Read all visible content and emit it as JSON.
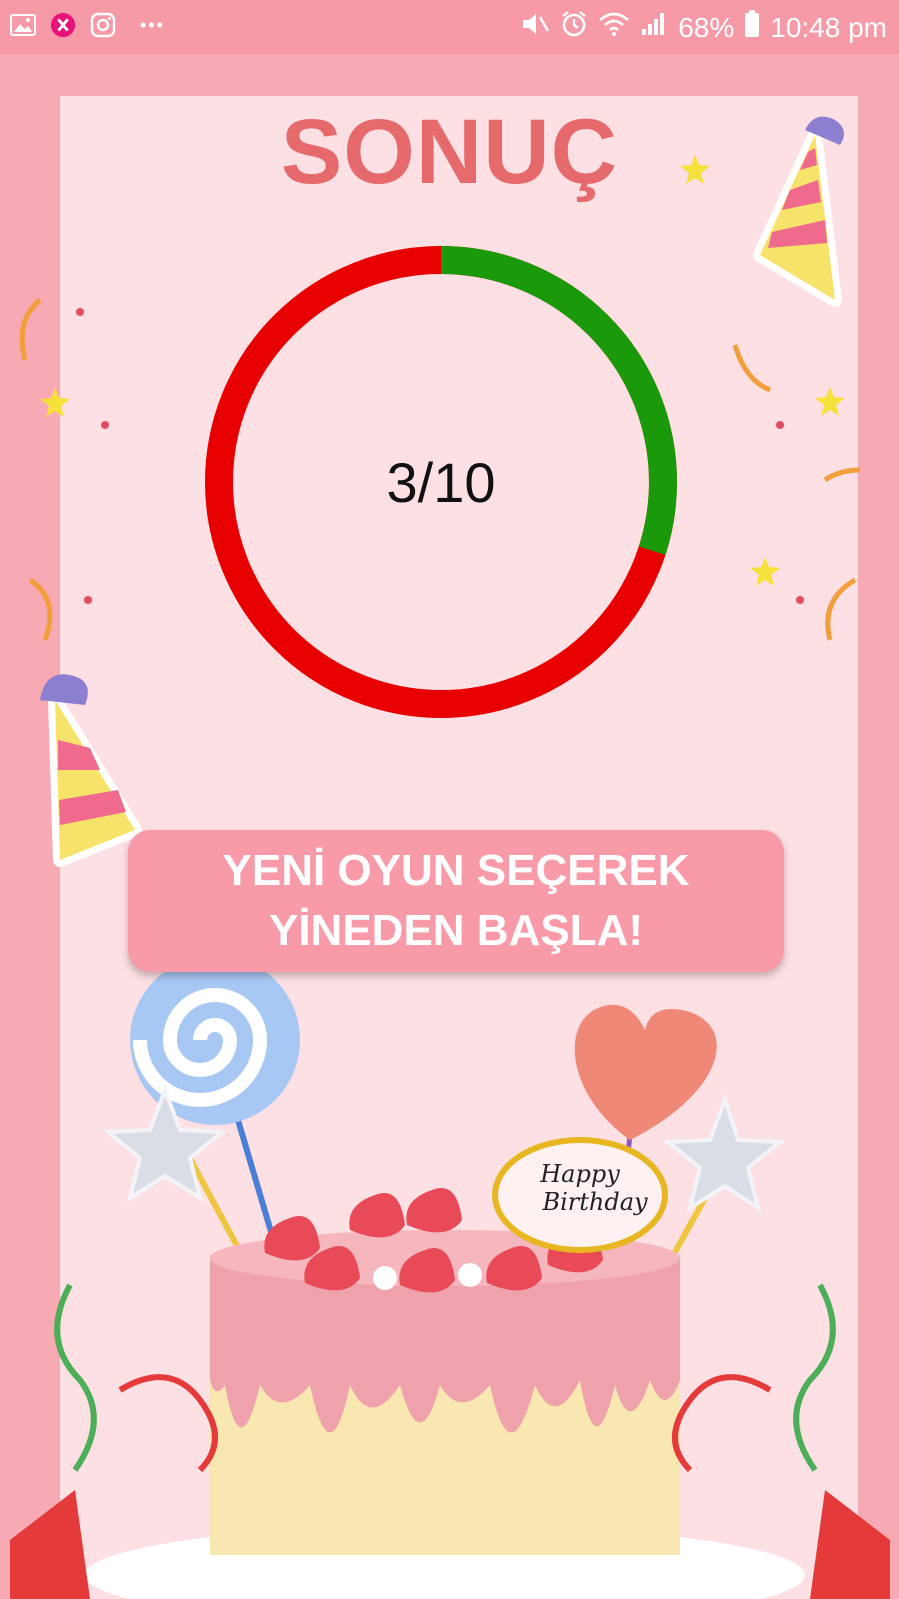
{
  "status_bar": {
    "battery_percent": "68%",
    "time": "10:48 pm",
    "overflow": "•••",
    "left_icons": [
      "gallery-icon",
      "app-notification-icon",
      "instagram-icon"
    ],
    "right_icons": [
      "mute-icon",
      "alarm-icon",
      "wifi-icon",
      "signal-icon",
      "battery-icon"
    ]
  },
  "result": {
    "title": "SONUÇ",
    "score_text": "3/10",
    "correct": 3,
    "total": 10,
    "colors": {
      "correct": "#1a9a0a",
      "wrong": "#e80000",
      "title": "#e66a6c"
    }
  },
  "action": {
    "line1": "YENİ OYUN SEÇEREK",
    "line2": "YİNEDEN BAŞLA!"
  },
  "decoration": {
    "card_text_1": "Happy",
    "card_text_2": "Birthday",
    "icons": [
      "party-hat-icon",
      "lollipop-icon",
      "heart-balloon-icon",
      "star-icon",
      "birthday-cake-icon"
    ]
  }
}
